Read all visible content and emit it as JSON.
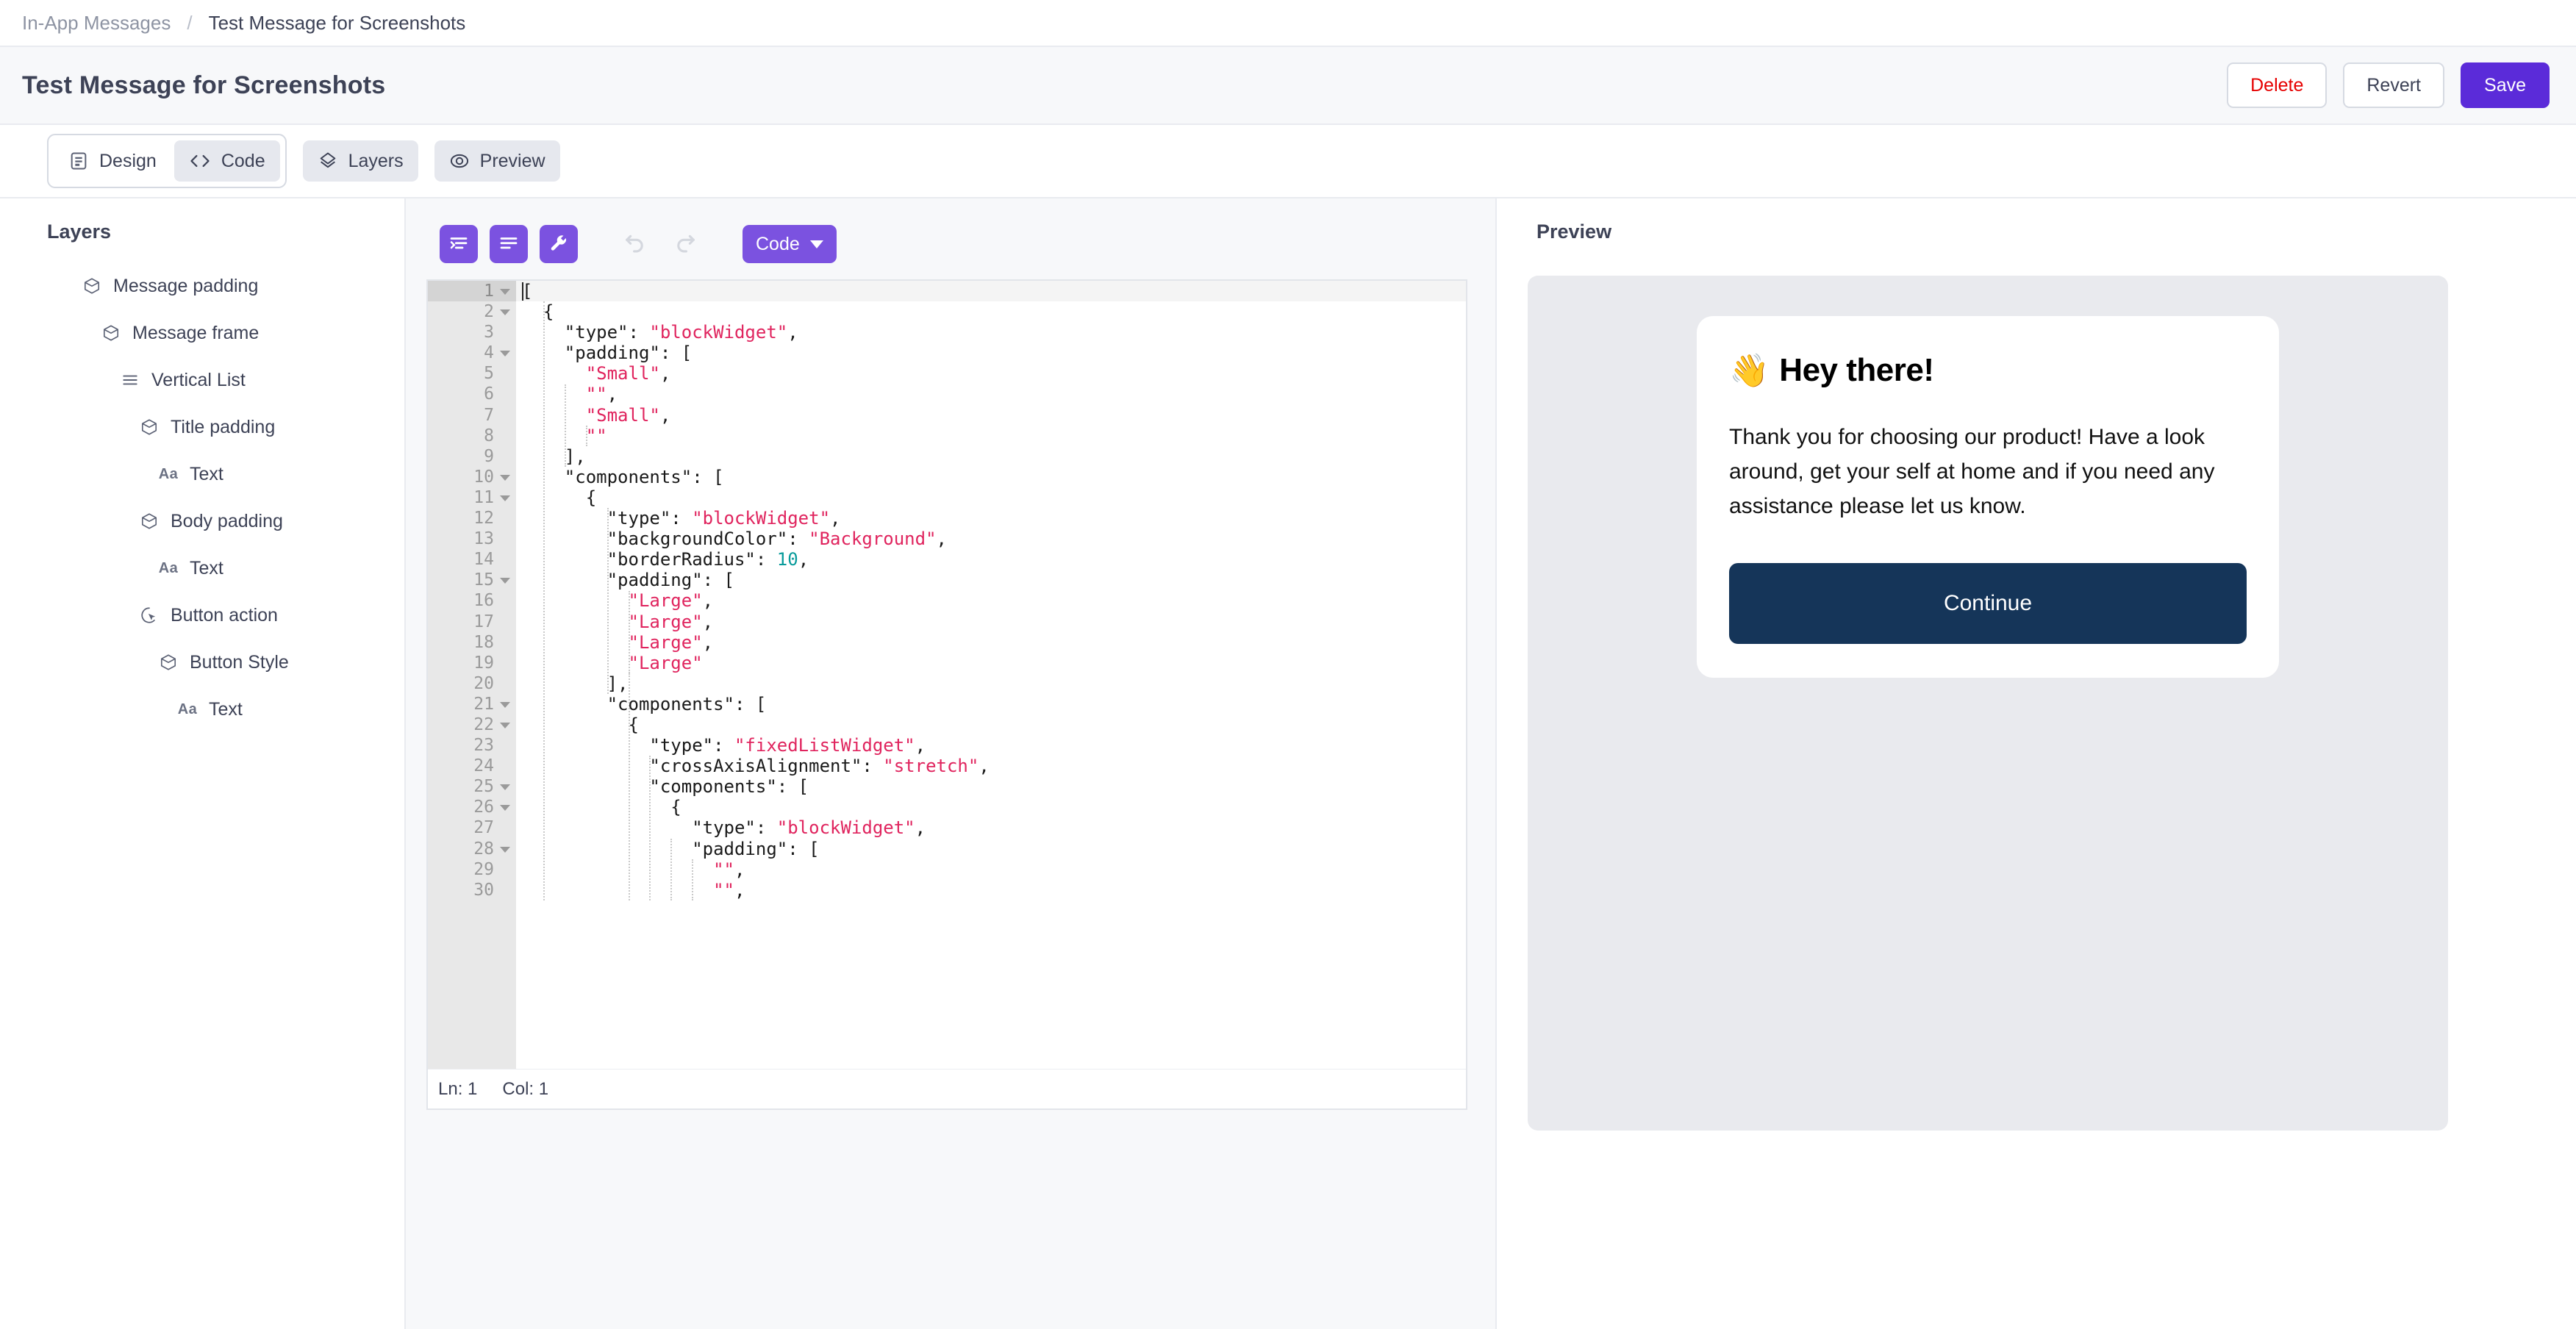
{
  "breadcrumb": {
    "parent": "In-App Messages",
    "separator": "/",
    "current": "Test Message for Screenshots"
  },
  "header": {
    "title": "Test Message for Screenshots",
    "delete_label": "Delete",
    "revert_label": "Revert",
    "save_label": "Save",
    "save_color": "#5b2bd9",
    "delete_color": "#e60000"
  },
  "tabs": [
    {
      "label": "Design",
      "icon": "document-lines-icon",
      "active": false
    },
    {
      "label": "Code",
      "icon": "angle-brackets-icon",
      "active": true
    },
    {
      "label": "Layers",
      "icon": "layers-diamond-icon",
      "active": true
    },
    {
      "label": "Preview",
      "icon": "eye-icon",
      "active": true
    }
  ],
  "layers": {
    "title": "Layers",
    "items": [
      {
        "label": "Message padding",
        "icon": "cube-icon",
        "depth": 0
      },
      {
        "label": "Message frame",
        "icon": "cube-icon",
        "depth": 1
      },
      {
        "label": "Vertical List",
        "icon": "list-icon",
        "depth": 2
      },
      {
        "label": "Title padding",
        "icon": "cube-icon",
        "depth": 3
      },
      {
        "label": "Text",
        "icon": "text-aa-icon",
        "depth": 4
      },
      {
        "label": "Body padding",
        "icon": "cube-icon",
        "depth": 3
      },
      {
        "label": "Text",
        "icon": "text-aa-icon",
        "depth": 4
      },
      {
        "label": "Button action",
        "icon": "cursor-click-icon",
        "depth": 3
      },
      {
        "label": "Button Style",
        "icon": "cube-icon",
        "depth": 4
      },
      {
        "label": "Text",
        "icon": "text-aa-icon",
        "depth": 5
      }
    ]
  },
  "editor": {
    "toolbar": {
      "format_indent_label": "format-indent",
      "format_align_label": "format-align",
      "tools_label": "tools",
      "undo_label": "undo",
      "redo_label": "redo",
      "mode_label": "Code"
    },
    "accent_color": "#7b52e0",
    "status": {
      "line_label": "Ln: 1",
      "col_label": "Col: 1"
    },
    "current_line": 1,
    "fold_lines": [
      1,
      2,
      4,
      10,
      11,
      15,
      21,
      22,
      25,
      26,
      28
    ],
    "lines": [
      {
        "n": 1,
        "tokens": [
          {
            "t": "[",
            "c": "key"
          }
        ]
      },
      {
        "n": 2,
        "tokens": [
          {
            "t": "  {",
            "c": "key"
          }
        ]
      },
      {
        "n": 3,
        "tokens": [
          {
            "t": "    \"type\": ",
            "c": "key"
          },
          {
            "t": "\"blockWidget\"",
            "c": "str"
          },
          {
            "t": ",",
            "c": "key"
          }
        ]
      },
      {
        "n": 4,
        "tokens": [
          {
            "t": "    \"padding\": [",
            "c": "key"
          }
        ]
      },
      {
        "n": 5,
        "tokens": [
          {
            "t": "      ",
            "c": "key"
          },
          {
            "t": "\"Small\"",
            "c": "str"
          },
          {
            "t": ",",
            "c": "key"
          }
        ]
      },
      {
        "n": 6,
        "tokens": [
          {
            "t": "      ",
            "c": "key"
          },
          {
            "t": "\"\"",
            "c": "str"
          },
          {
            "t": ",",
            "c": "key"
          }
        ]
      },
      {
        "n": 7,
        "tokens": [
          {
            "t": "      ",
            "c": "key"
          },
          {
            "t": "\"Small\"",
            "c": "str"
          },
          {
            "t": ",",
            "c": "key"
          }
        ]
      },
      {
        "n": 8,
        "tokens": [
          {
            "t": "      ",
            "c": "key"
          },
          {
            "t": "\"\"",
            "c": "str"
          }
        ]
      },
      {
        "n": 9,
        "tokens": [
          {
            "t": "    ],",
            "c": "key"
          }
        ]
      },
      {
        "n": 10,
        "tokens": [
          {
            "t": "    \"components\": [",
            "c": "key"
          }
        ]
      },
      {
        "n": 11,
        "tokens": [
          {
            "t": "      {",
            "c": "key"
          }
        ]
      },
      {
        "n": 12,
        "tokens": [
          {
            "t": "        \"type\": ",
            "c": "key"
          },
          {
            "t": "\"blockWidget\"",
            "c": "str"
          },
          {
            "t": ",",
            "c": "key"
          }
        ]
      },
      {
        "n": 13,
        "tokens": [
          {
            "t": "        \"backgroundColor\": ",
            "c": "key"
          },
          {
            "t": "\"Background\"",
            "c": "str"
          },
          {
            "t": ",",
            "c": "key"
          }
        ]
      },
      {
        "n": 14,
        "tokens": [
          {
            "t": "        \"borderRadius\": ",
            "c": "key"
          },
          {
            "t": "10",
            "c": "num"
          },
          {
            "t": ",",
            "c": "key"
          }
        ]
      },
      {
        "n": 15,
        "tokens": [
          {
            "t": "        \"padding\": [",
            "c": "key"
          }
        ]
      },
      {
        "n": 16,
        "tokens": [
          {
            "t": "          ",
            "c": "key"
          },
          {
            "t": "\"Large\"",
            "c": "str"
          },
          {
            "t": ",",
            "c": "key"
          }
        ]
      },
      {
        "n": 17,
        "tokens": [
          {
            "t": "          ",
            "c": "key"
          },
          {
            "t": "\"Large\"",
            "c": "str"
          },
          {
            "t": ",",
            "c": "key"
          }
        ]
      },
      {
        "n": 18,
        "tokens": [
          {
            "t": "          ",
            "c": "key"
          },
          {
            "t": "\"Large\"",
            "c": "str"
          },
          {
            "t": ",",
            "c": "key"
          }
        ]
      },
      {
        "n": 19,
        "tokens": [
          {
            "t": "          ",
            "c": "key"
          },
          {
            "t": "\"Large\"",
            "c": "str"
          }
        ]
      },
      {
        "n": 20,
        "tokens": [
          {
            "t": "        ],",
            "c": "key"
          }
        ]
      },
      {
        "n": 21,
        "tokens": [
          {
            "t": "        \"components\": [",
            "c": "key"
          }
        ]
      },
      {
        "n": 22,
        "tokens": [
          {
            "t": "          {",
            "c": "key"
          }
        ]
      },
      {
        "n": 23,
        "tokens": [
          {
            "t": "            \"type\": ",
            "c": "key"
          },
          {
            "t": "\"fixedListWidget\"",
            "c": "str"
          },
          {
            "t": ",",
            "c": "key"
          }
        ]
      },
      {
        "n": 24,
        "tokens": [
          {
            "t": "            \"crossAxisAlignment\": ",
            "c": "key"
          },
          {
            "t": "\"stretch\"",
            "c": "str"
          },
          {
            "t": ",",
            "c": "key"
          }
        ]
      },
      {
        "n": 25,
        "tokens": [
          {
            "t": "            \"components\": [",
            "c": "key"
          }
        ]
      },
      {
        "n": 26,
        "tokens": [
          {
            "t": "              {",
            "c": "key"
          }
        ]
      },
      {
        "n": 27,
        "tokens": [
          {
            "t": "                \"type\": ",
            "c": "key"
          },
          {
            "t": "\"blockWidget\"",
            "c": "str"
          },
          {
            "t": ",",
            "c": "key"
          }
        ]
      },
      {
        "n": 28,
        "tokens": [
          {
            "t": "                \"padding\": [",
            "c": "key"
          }
        ]
      },
      {
        "n": 29,
        "tokens": [
          {
            "t": "                  ",
            "c": "key"
          },
          {
            "t": "\"\"",
            "c": "str"
          },
          {
            "t": ",",
            "c": "key"
          }
        ]
      },
      {
        "n": 30,
        "tokens": [
          {
            "t": "                  ",
            "c": "key"
          },
          {
            "t": "\"\"",
            "c": "str"
          },
          {
            "t": ",",
            "c": "key"
          }
        ]
      }
    ],
    "colors": {
      "string": "#e0245e",
      "number": "#089b9b",
      "plain": "#1a1a1a"
    }
  },
  "preview": {
    "title": "Preview",
    "message": {
      "emoji": "👋",
      "heading": "Hey there!",
      "body": "Thank you for choosing our product! Have a look around, get your self at home and if you need any assistance please let us know.",
      "button_label": "Continue",
      "button_color": "#153559"
    }
  }
}
